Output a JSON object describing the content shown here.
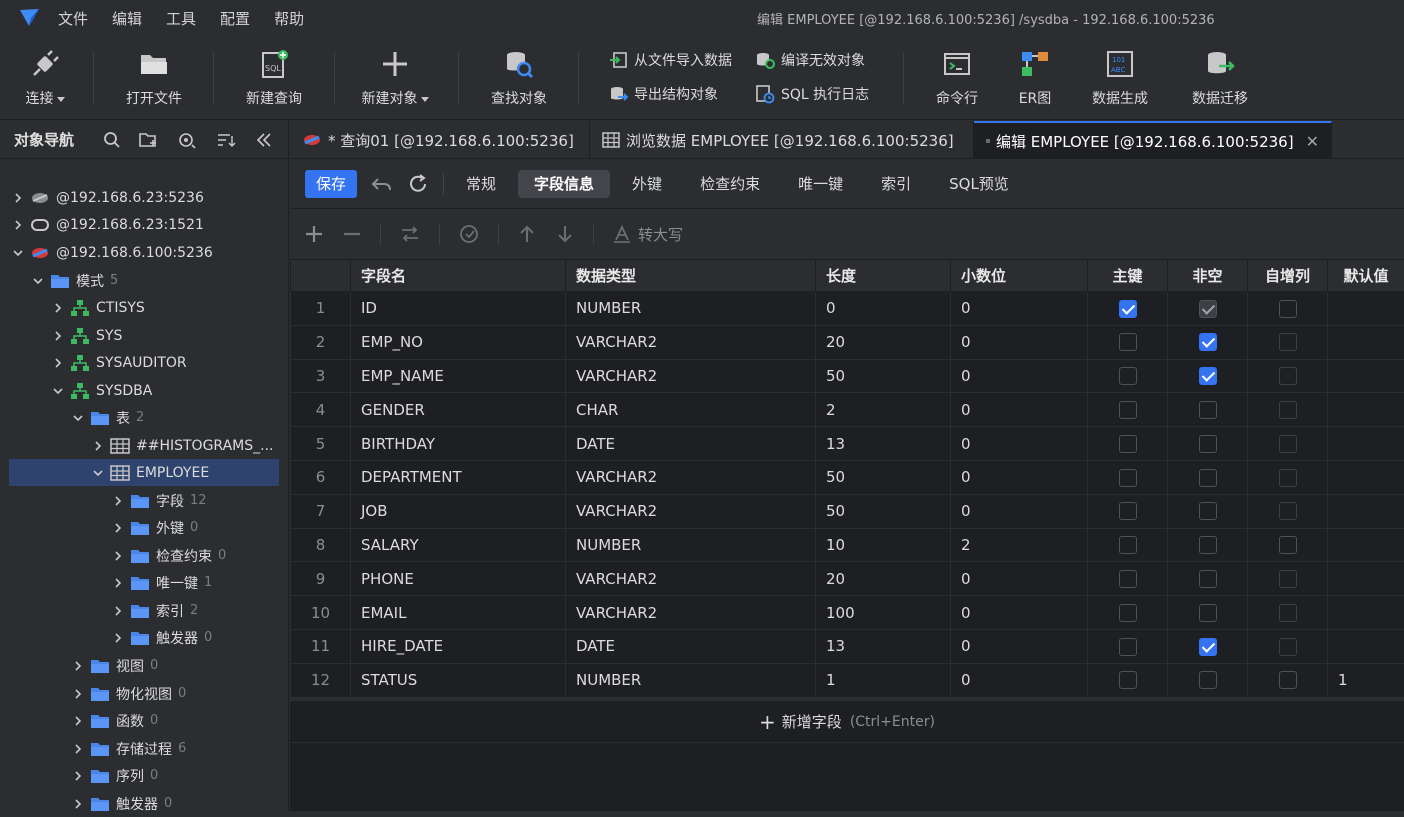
{
  "menubar": {
    "items": [
      "文件",
      "编辑",
      "工具",
      "配置",
      "帮助"
    ],
    "window_title": "编辑 EMPLOYEE [@192.168.6.100:5236] /sysdba  - 192.168.6.100:5236"
  },
  "toolbar": {
    "connect": "连接",
    "open_file": "打开文件",
    "new_query": "新建查询",
    "new_object": "新建对象",
    "find_object": "查找对象",
    "import_data": "从文件导入数据",
    "export_struct": "导出结构对象",
    "compile_invalid": "编译无效对象",
    "sql_log": "SQL 执行日志",
    "cmd": "命令行",
    "er": "ER图",
    "data_gen": "数据生成",
    "data_migrate": "数据迁移"
  },
  "sidebar": {
    "title": "对象导航",
    "nodes": [
      {
        "label": "@192.168.6.23:5236",
        "count": ""
      },
      {
        "label": "@192.168.6.23:1521",
        "count": ""
      },
      {
        "label": "@192.168.6.100:5236",
        "count": ""
      },
      {
        "label": "模式",
        "count": "5"
      },
      {
        "label": "CTISYS",
        "count": ""
      },
      {
        "label": "SYS",
        "count": ""
      },
      {
        "label": "SYSAUDITOR",
        "count": ""
      },
      {
        "label": "SYSDBA",
        "count": ""
      },
      {
        "label": "表",
        "count": "2"
      },
      {
        "label": "##HISTOGRAMS_...",
        "count": ""
      },
      {
        "label": "EMPLOYEE",
        "count": ""
      },
      {
        "label": "字段",
        "count": "12"
      },
      {
        "label": "外键",
        "count": "0"
      },
      {
        "label": "检查约束",
        "count": "0"
      },
      {
        "label": "唯一键",
        "count": "1"
      },
      {
        "label": "索引",
        "count": "2"
      },
      {
        "label": "触发器",
        "count": "0"
      },
      {
        "label": "视图",
        "count": "0"
      },
      {
        "label": "物化视图",
        "count": "0"
      },
      {
        "label": "函数",
        "count": "0"
      },
      {
        "label": "存储过程",
        "count": "6"
      },
      {
        "label": "序列",
        "count": "0"
      },
      {
        "label": "触发器",
        "count": "0"
      }
    ]
  },
  "tabs": [
    {
      "label": "* 查询01 [@192.168.6.100:5236]"
    },
    {
      "label": "浏览数据 EMPLOYEE [@192.168.6.100:5236]"
    },
    {
      "label": "编辑 EMPLOYEE [@192.168.6.100:5236]"
    }
  ],
  "editor": {
    "save": "保存",
    "subtabs": [
      "常规",
      "字段信息",
      "外键",
      "检查约束",
      "唯一键",
      "索引",
      "SQL预览"
    ],
    "uppercase": "转大写",
    "columns": [
      "字段名",
      "数据类型",
      "长度",
      "小数位",
      "主键",
      "非空",
      "自增列",
      "默认值"
    ],
    "rows": [
      {
        "n": "1",
        "name": "ID",
        "type": "NUMBER",
        "len": "0",
        "scale": "0",
        "pk": "on",
        "nn": "dis",
        "ai": "off",
        "def": ""
      },
      {
        "n": "2",
        "name": "EMP_NO",
        "type": "VARCHAR2",
        "len": "20",
        "scale": "0",
        "pk": "off",
        "nn": "on",
        "ai": "dis0",
        "def": ""
      },
      {
        "n": "3",
        "name": "EMP_NAME",
        "type": "VARCHAR2",
        "len": "50",
        "scale": "0",
        "pk": "off",
        "nn": "on",
        "ai": "dis0",
        "def": ""
      },
      {
        "n": "4",
        "name": "GENDER",
        "type": "CHAR",
        "len": "2",
        "scale": "0",
        "pk": "off",
        "nn": "off",
        "ai": "dis0",
        "def": ""
      },
      {
        "n": "5",
        "name": "BIRTHDAY",
        "type": "DATE",
        "len": "13",
        "scale": "0",
        "pk": "off",
        "nn": "off",
        "ai": "dis0",
        "def": ""
      },
      {
        "n": "6",
        "name": "DEPARTMENT",
        "type": "VARCHAR2",
        "len": "50",
        "scale": "0",
        "pk": "off",
        "nn": "off",
        "ai": "dis0",
        "def": ""
      },
      {
        "n": "7",
        "name": "JOB",
        "type": "VARCHAR2",
        "len": "50",
        "scale": "0",
        "pk": "off",
        "nn": "off",
        "ai": "dis0",
        "def": ""
      },
      {
        "n": "8",
        "name": "SALARY",
        "type": "NUMBER",
        "len": "10",
        "scale": "2",
        "pk": "off",
        "nn": "off",
        "ai": "off",
        "def": ""
      },
      {
        "n": "9",
        "name": "PHONE",
        "type": "VARCHAR2",
        "len": "20",
        "scale": "0",
        "pk": "off",
        "nn": "off",
        "ai": "dis0",
        "def": ""
      },
      {
        "n": "10",
        "name": "EMAIL",
        "type": "VARCHAR2",
        "len": "100",
        "scale": "0",
        "pk": "off",
        "nn": "off",
        "ai": "dis0",
        "def": ""
      },
      {
        "n": "11",
        "name": "HIRE_DATE",
        "type": "DATE",
        "len": "13",
        "scale": "0",
        "pk": "off",
        "nn": "on",
        "ai": "dis0",
        "def": ""
      },
      {
        "n": "12",
        "name": "STATUS",
        "type": "NUMBER",
        "len": "1",
        "scale": "0",
        "pk": "off",
        "nn": "off",
        "ai": "off",
        "def": "1"
      }
    ],
    "add_field": "新增字段",
    "add_hint": "(Ctrl+Enter)"
  }
}
